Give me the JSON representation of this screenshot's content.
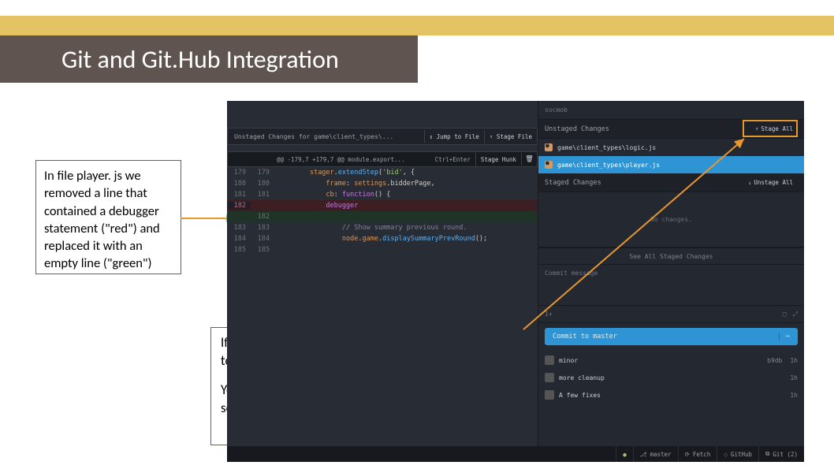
{
  "slide": {
    "title": "Git and Git.Hub Integration",
    "callout1": "In file player. js we removed a line that contained a debugger statement (\"red\") and replaced it with an empty line (\"green\")",
    "callout2a": "If we are happy with the changes, click on \"Stage All\" to add all files to the index.",
    "callout2b": "You can also double click on a single file to select only some of the changed files to be added to the index."
  },
  "diff": {
    "header_label": "Unstaged Changes for game\\client_types\\...",
    "jump_btn": "↕ Jump to File",
    "stage_file_btn": "⇡ Stage File",
    "hunk": "@@ -179,7 +179,7 @@ module.export...",
    "kbd": "Ctrl+Enter",
    "stage_hunk": "Stage Hunk",
    "rows": [
      {
        "ln": "179",
        "ln2": "179",
        "cls": "",
        "txt": "        stager.extendStep('bid', {"
      },
      {
        "ln": "180",
        "ln2": "180",
        "cls": "",
        "txt": "            frame: settings.bidderPage,"
      },
      {
        "ln": "181",
        "ln2": "181",
        "cls": "",
        "txt": "            cb: function() {"
      },
      {
        "ln": "182",
        "ln2": "",
        "cls": "del",
        "txt": "            debugger"
      },
      {
        "ln": "",
        "ln2": "182",
        "cls": "add",
        "txt": " "
      },
      {
        "ln": "183",
        "ln2": "183",
        "cls": "",
        "txt": "                // Show summary previous round."
      },
      {
        "ln": "184",
        "ln2": "184",
        "cls": "",
        "txt": "                node.game.displaySummaryPrevRound();"
      },
      {
        "ln": "185",
        "ln2": "185",
        "cls": "",
        "txt": ""
      }
    ]
  },
  "right": {
    "search_placeholder": "socmob",
    "unstaged_hd": "Unstaged Changes",
    "stage_all": "Stage All",
    "files": [
      {
        "path": "game\\client_types\\logic.js",
        "sel": false
      },
      {
        "path": "game\\client_types\\player.js",
        "sel": true
      }
    ],
    "staged_hd": "Staged Changes",
    "unstage_all": "Unstage All",
    "no_changes": "No changes.",
    "see_all": "See All Staged Changes",
    "commit_placeholder": "Commit message",
    "branch_indicator": "1+",
    "commit_btn": "Commit to master",
    "history": [
      {
        "msg": "minor",
        "hash": "b9db",
        "age": "1h"
      },
      {
        "msg": "more cleanup",
        "hash": "",
        "age": "1h"
      },
      {
        "msg": "A few fixes",
        "hash": "",
        "age": "1h"
      }
    ]
  },
  "status": {
    "branch": "master",
    "fetch": "Fetch",
    "github": "GitHub",
    "files": "Git (2)"
  }
}
